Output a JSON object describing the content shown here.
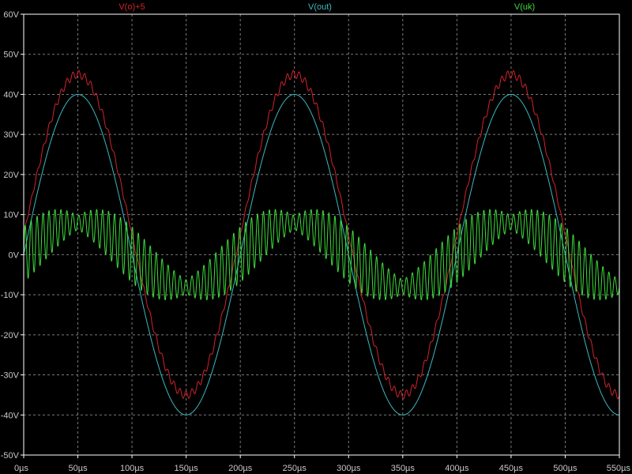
{
  "chart_data": {
    "type": "line",
    "x_unit": "µs",
    "y_unit": "V",
    "xlim": [
      0,
      550
    ],
    "ylim": [
      -50,
      60
    ],
    "x_ticks": [
      "0µs",
      "50µs",
      "100µs",
      "150µs",
      "200µs",
      "250µs",
      "300µs",
      "350µs",
      "400µs",
      "450µs",
      "500µs",
      "550µs"
    ],
    "y_ticks": [
      "60V",
      "50V",
      "40V",
      "30V",
      "20V",
      "10V",
      "0V",
      "-10V",
      "-20V",
      "-30V",
      "-40V",
      "-50V"
    ],
    "grid": true,
    "grid_style": "dashed",
    "legend_position": "top",
    "background": "#000000",
    "axis_color": "#ffffff",
    "series": [
      {
        "name": "V(o)+5",
        "color": "#d2222d",
        "offset_v": 5,
        "amplitude_v": 40,
        "period_us": 200,
        "peak_at_us": 50,
        "ripple_amplitude_v": 1.0,
        "ripple_period_us": 5.5,
        "points": [
          [
            0,
            5
          ],
          [
            50,
            45
          ],
          [
            150,
            -35
          ],
          [
            250,
            45
          ],
          [
            350,
            -35
          ],
          [
            450,
            45
          ],
          [
            550,
            -35
          ]
        ]
      },
      {
        "name": "V(out)",
        "color": "#3bb8bf",
        "offset_v": 0,
        "amplitude_v": 40,
        "period_us": 200,
        "peak_at_us": 50,
        "points": [
          [
            0,
            0
          ],
          [
            50,
            40
          ],
          [
            150,
            -40
          ],
          [
            250,
            40
          ],
          [
            350,
            -40
          ],
          [
            450,
            40
          ],
          [
            550,
            -40
          ]
        ]
      },
      {
        "name": "V(uk)",
        "color": "#3ddc3a",
        "offset_v": 0,
        "amplitude_v": 8,
        "period_us": 200,
        "peak_at_us": 250,
        "ripple_amplitude_v": 7,
        "ripple_period_us": 5.5,
        "points": [
          [
            0,
            5
          ],
          [
            50,
            -8
          ],
          [
            100,
            0
          ],
          [
            150,
            8
          ],
          [
            200,
            0
          ],
          [
            250,
            -8
          ],
          [
            300,
            0
          ],
          [
            350,
            8
          ],
          [
            400,
            0
          ],
          [
            450,
            -8
          ],
          [
            500,
            0
          ],
          [
            550,
            8
          ]
        ]
      }
    ]
  }
}
